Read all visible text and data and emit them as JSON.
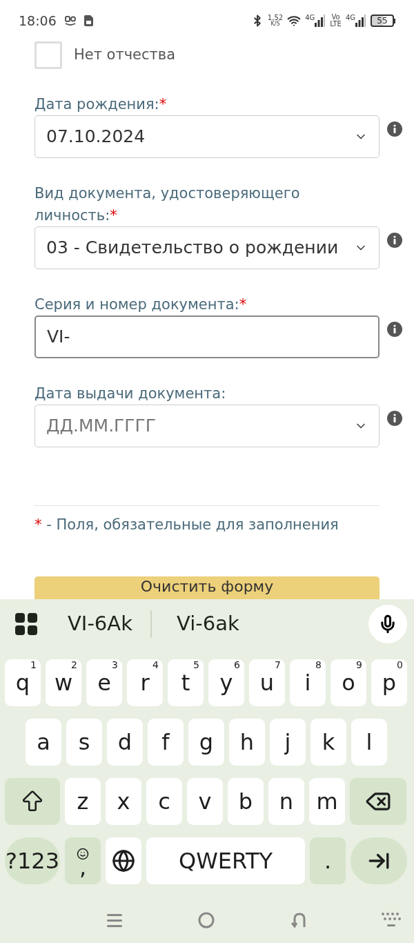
{
  "status_bar": {
    "time": "18:06",
    "speed": "1,52",
    "speed_unit": "K/S",
    "networks": [
      {
        "kind": "signal",
        "label": "4G"
      },
      {
        "kind": "volte",
        "label": "Vo",
        "label2": "LTE"
      },
      {
        "kind": "signal",
        "label": "4G"
      }
    ],
    "battery": "55"
  },
  "form": {
    "no_patronymic": {
      "label": "Нет отчества",
      "checked": false
    },
    "fields": [
      {
        "label": "Дата рождения:",
        "required_mark": "*",
        "kind": "select",
        "value": "07.10.2024",
        "focused": false
      },
      {
        "label": "Вид документа, удостоверяющего личность:",
        "required_mark": "*",
        "kind": "select",
        "value": "03 - Свидетельство о рождении",
        "focused": false
      },
      {
        "label": "Серия и номер документа:",
        "required_mark": "*",
        "kind": "text",
        "value": "VI-",
        "focused": true
      },
      {
        "label": "Дата выдачи документа:",
        "kind": "select",
        "placeholder": "ДД.ММ.ГГГГ",
        "focused": false
      }
    ],
    "required_note": {
      "mark": "*",
      "text": "- Поля, обязательные для заполнения"
    },
    "clear_button": "Очистить форму"
  },
  "keyboard": {
    "suggestions": [
      "VI-6Ak",
      "Vi-6ak"
    ],
    "rows": [
      {
        "keys": [
          {
            "kind": "letter",
            "label": "q",
            "hint": "1"
          },
          {
            "kind": "letter",
            "label": "w",
            "hint": "2"
          },
          {
            "kind": "letter",
            "label": "e",
            "hint": "3"
          },
          {
            "kind": "letter",
            "label": "r",
            "hint": "4"
          },
          {
            "kind": "letter",
            "label": "t",
            "hint": "5"
          },
          {
            "kind": "letter",
            "label": "y",
            "hint": "6"
          },
          {
            "kind": "letter",
            "label": "u",
            "hint": "7"
          },
          {
            "kind": "letter",
            "label": "i",
            "hint": "8"
          },
          {
            "kind": "letter",
            "label": "o",
            "hint": "9"
          },
          {
            "kind": "letter",
            "label": "p",
            "hint": "0"
          }
        ]
      },
      {
        "keys": [
          {
            "kind": "letter",
            "label": "a"
          },
          {
            "kind": "letter",
            "label": "s"
          },
          {
            "kind": "letter",
            "label": "d"
          },
          {
            "kind": "letter",
            "label": "f"
          },
          {
            "kind": "letter",
            "label": "g"
          },
          {
            "kind": "letter",
            "label": "h"
          },
          {
            "kind": "letter",
            "label": "j"
          },
          {
            "kind": "letter",
            "label": "k"
          },
          {
            "kind": "letter",
            "label": "l"
          }
        ]
      },
      {
        "keys": [
          {
            "kind": "shift"
          },
          {
            "kind": "letter",
            "label": "z"
          },
          {
            "kind": "letter",
            "label": "x"
          },
          {
            "kind": "letter",
            "label": "c"
          },
          {
            "kind": "letter",
            "label": "v"
          },
          {
            "kind": "letter",
            "label": "b"
          },
          {
            "kind": "letter",
            "label": "n"
          },
          {
            "kind": "letter",
            "label": "m"
          },
          {
            "kind": "backspace"
          }
        ]
      },
      {
        "keys": [
          {
            "kind": "symbols",
            "label": "?123"
          },
          {
            "kind": "emoji",
            "label": ","
          },
          {
            "kind": "globe"
          },
          {
            "kind": "space",
            "label": "QWERTY"
          },
          {
            "kind": "period",
            "label": "."
          },
          {
            "kind": "enter"
          }
        ]
      }
    ]
  }
}
